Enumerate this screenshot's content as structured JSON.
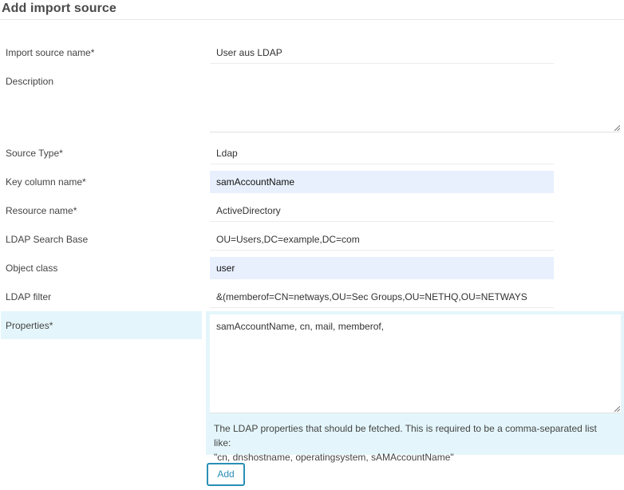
{
  "title": "Add import source",
  "fields": {
    "import_source_name": {
      "label": "Import source name*",
      "value": "User aus LDAP"
    },
    "description": {
      "label": "Description",
      "value": ""
    },
    "source_type": {
      "label": "Source Type*",
      "value": "Ldap"
    },
    "key_column_name": {
      "label": "Key column name*",
      "value": "samAccountName"
    },
    "resource_name": {
      "label": "Resource name*",
      "value": "ActiveDirectory"
    },
    "ldap_search_base": {
      "label": "LDAP Search Base",
      "value": "OU=Users,DC=example,DC=com"
    },
    "object_class": {
      "label": "Object class",
      "value": "user"
    },
    "ldap_filter": {
      "label": "LDAP filter",
      "value": "&(memberof=CN=netways,OU=Sec Groups,OU=NETHQ,OU=NETWAYS"
    },
    "properties": {
      "label": "Properties*",
      "value": "samAccountName, cn, mail, memberof,",
      "hint_line1": "The LDAP properties that should be fetched. This is required to be a comma-separated list like:",
      "hint_line2": "\"cn, dnshostname, operatingsystem, sAMAccountName\""
    }
  },
  "buttons": {
    "add_label": "Add"
  },
  "colors": {
    "focus_bg": "#e8f0fe",
    "active_row_bg": "#e4f6fb",
    "button_accent": "#2a8fb5"
  }
}
